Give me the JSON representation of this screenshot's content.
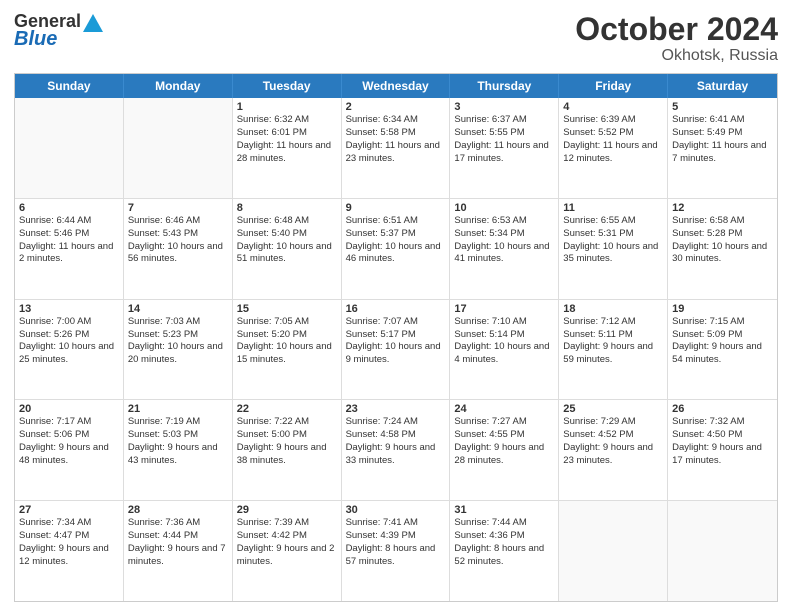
{
  "header": {
    "logo_general": "General",
    "logo_blue": "Blue",
    "month_title": "October 2024",
    "location": "Okhotsk, Russia"
  },
  "days_of_week": [
    "Sunday",
    "Monday",
    "Tuesday",
    "Wednesday",
    "Thursday",
    "Friday",
    "Saturday"
  ],
  "weeks": [
    [
      {
        "day": "",
        "text": ""
      },
      {
        "day": "",
        "text": ""
      },
      {
        "day": "1",
        "text": "Sunrise: 6:32 AM\nSunset: 6:01 PM\nDaylight: 11 hours and 28 minutes."
      },
      {
        "day": "2",
        "text": "Sunrise: 6:34 AM\nSunset: 5:58 PM\nDaylight: 11 hours and 23 minutes."
      },
      {
        "day": "3",
        "text": "Sunrise: 6:37 AM\nSunset: 5:55 PM\nDaylight: 11 hours and 17 minutes."
      },
      {
        "day": "4",
        "text": "Sunrise: 6:39 AM\nSunset: 5:52 PM\nDaylight: 11 hours and 12 minutes."
      },
      {
        "day": "5",
        "text": "Sunrise: 6:41 AM\nSunset: 5:49 PM\nDaylight: 11 hours and 7 minutes."
      }
    ],
    [
      {
        "day": "6",
        "text": "Sunrise: 6:44 AM\nSunset: 5:46 PM\nDaylight: 11 hours and 2 minutes."
      },
      {
        "day": "7",
        "text": "Sunrise: 6:46 AM\nSunset: 5:43 PM\nDaylight: 10 hours and 56 minutes."
      },
      {
        "day": "8",
        "text": "Sunrise: 6:48 AM\nSunset: 5:40 PM\nDaylight: 10 hours and 51 minutes."
      },
      {
        "day": "9",
        "text": "Sunrise: 6:51 AM\nSunset: 5:37 PM\nDaylight: 10 hours and 46 minutes."
      },
      {
        "day": "10",
        "text": "Sunrise: 6:53 AM\nSunset: 5:34 PM\nDaylight: 10 hours and 41 minutes."
      },
      {
        "day": "11",
        "text": "Sunrise: 6:55 AM\nSunset: 5:31 PM\nDaylight: 10 hours and 35 minutes."
      },
      {
        "day": "12",
        "text": "Sunrise: 6:58 AM\nSunset: 5:28 PM\nDaylight: 10 hours and 30 minutes."
      }
    ],
    [
      {
        "day": "13",
        "text": "Sunrise: 7:00 AM\nSunset: 5:26 PM\nDaylight: 10 hours and 25 minutes."
      },
      {
        "day": "14",
        "text": "Sunrise: 7:03 AM\nSunset: 5:23 PM\nDaylight: 10 hours and 20 minutes."
      },
      {
        "day": "15",
        "text": "Sunrise: 7:05 AM\nSunset: 5:20 PM\nDaylight: 10 hours and 15 minutes."
      },
      {
        "day": "16",
        "text": "Sunrise: 7:07 AM\nSunset: 5:17 PM\nDaylight: 10 hours and 9 minutes."
      },
      {
        "day": "17",
        "text": "Sunrise: 7:10 AM\nSunset: 5:14 PM\nDaylight: 10 hours and 4 minutes."
      },
      {
        "day": "18",
        "text": "Sunrise: 7:12 AM\nSunset: 5:11 PM\nDaylight: 9 hours and 59 minutes."
      },
      {
        "day": "19",
        "text": "Sunrise: 7:15 AM\nSunset: 5:09 PM\nDaylight: 9 hours and 54 minutes."
      }
    ],
    [
      {
        "day": "20",
        "text": "Sunrise: 7:17 AM\nSunset: 5:06 PM\nDaylight: 9 hours and 48 minutes."
      },
      {
        "day": "21",
        "text": "Sunrise: 7:19 AM\nSunset: 5:03 PM\nDaylight: 9 hours and 43 minutes."
      },
      {
        "day": "22",
        "text": "Sunrise: 7:22 AM\nSunset: 5:00 PM\nDaylight: 9 hours and 38 minutes."
      },
      {
        "day": "23",
        "text": "Sunrise: 7:24 AM\nSunset: 4:58 PM\nDaylight: 9 hours and 33 minutes."
      },
      {
        "day": "24",
        "text": "Sunrise: 7:27 AM\nSunset: 4:55 PM\nDaylight: 9 hours and 28 minutes."
      },
      {
        "day": "25",
        "text": "Sunrise: 7:29 AM\nSunset: 4:52 PM\nDaylight: 9 hours and 23 minutes."
      },
      {
        "day": "26",
        "text": "Sunrise: 7:32 AM\nSunset: 4:50 PM\nDaylight: 9 hours and 17 minutes."
      }
    ],
    [
      {
        "day": "27",
        "text": "Sunrise: 7:34 AM\nSunset: 4:47 PM\nDaylight: 9 hours and 12 minutes."
      },
      {
        "day": "28",
        "text": "Sunrise: 7:36 AM\nSunset: 4:44 PM\nDaylight: 9 hours and 7 minutes."
      },
      {
        "day": "29",
        "text": "Sunrise: 7:39 AM\nSunset: 4:42 PM\nDaylight: 9 hours and 2 minutes."
      },
      {
        "day": "30",
        "text": "Sunrise: 7:41 AM\nSunset: 4:39 PM\nDaylight: 8 hours and 57 minutes."
      },
      {
        "day": "31",
        "text": "Sunrise: 7:44 AM\nSunset: 4:36 PM\nDaylight: 8 hours and 52 minutes."
      },
      {
        "day": "",
        "text": ""
      },
      {
        "day": "",
        "text": ""
      }
    ]
  ]
}
